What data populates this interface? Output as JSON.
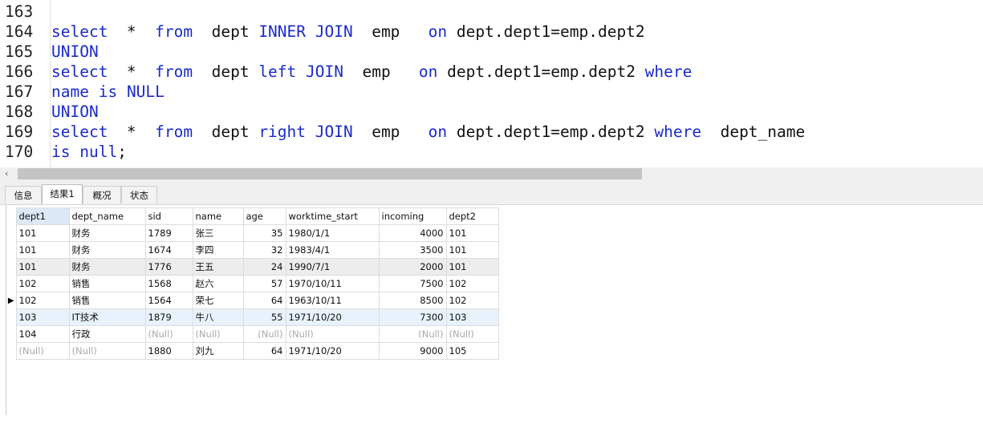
{
  "editor": {
    "lines": [
      {
        "num": "163",
        "tokens": []
      },
      {
        "num": "164",
        "tokens": [
          {
            "t": "select",
            "kw": true
          },
          {
            "t": "  *  ",
            "kw": false
          },
          {
            "t": "from",
            "kw": true
          },
          {
            "t": "  dept ",
            "kw": false
          },
          {
            "t": "INNER JOIN",
            "kw": true
          },
          {
            "t": "  emp   ",
            "kw": false
          },
          {
            "t": "on",
            "kw": true
          },
          {
            "t": " dept.dept1=emp.dept2",
            "kw": false
          }
        ]
      },
      {
        "num": "165",
        "tokens": [
          {
            "t": "UNION",
            "kw": true
          }
        ]
      },
      {
        "num": "166",
        "tokens": [
          {
            "t": "select",
            "kw": true
          },
          {
            "t": "  *  ",
            "kw": false
          },
          {
            "t": "from",
            "kw": true
          },
          {
            "t": "  dept ",
            "kw": false
          },
          {
            "t": "left JOIN",
            "kw": true
          },
          {
            "t": "  emp   ",
            "kw": false
          },
          {
            "t": "on",
            "kw": true
          },
          {
            "t": " dept.dept1=emp.dept2 ",
            "kw": false
          },
          {
            "t": "where",
            "kw": true
          }
        ]
      },
      {
        "num": "167",
        "tokens": [
          {
            "t": "name ",
            "kw": true
          },
          {
            "t": "is",
            "kw": true
          },
          {
            "t": " ",
            "kw": false
          },
          {
            "t": "NULL",
            "kw": true
          }
        ]
      },
      {
        "num": "168",
        "tokens": [
          {
            "t": "UNION",
            "kw": true
          }
        ]
      },
      {
        "num": "169",
        "tokens": [
          {
            "t": "select",
            "kw": true
          },
          {
            "t": "  *  ",
            "kw": false
          },
          {
            "t": "from",
            "kw": true
          },
          {
            "t": "  dept ",
            "kw": false
          },
          {
            "t": "right JOIN",
            "kw": true
          },
          {
            "t": "  emp   ",
            "kw": false
          },
          {
            "t": "on",
            "kw": true
          },
          {
            "t": " dept.dept1=emp.dept2 ",
            "kw": false
          },
          {
            "t": "where",
            "kw": true
          },
          {
            "t": "  dept_name",
            "kw": false
          }
        ]
      },
      {
        "num": "170",
        "tokens": [
          {
            "t": "is",
            "kw": true
          },
          {
            "t": " ",
            "kw": false
          },
          {
            "t": "null",
            "kw": true
          },
          {
            "t": ";",
            "kw": false
          }
        ]
      }
    ]
  },
  "scrollbar": {
    "left_arrow": "‹"
  },
  "tabs": [
    {
      "label": "信息",
      "active": false
    },
    {
      "label": "结果1",
      "active": true
    },
    {
      "label": "概况",
      "active": false
    },
    {
      "label": "状态",
      "active": false
    }
  ],
  "grid": {
    "columns": [
      "dept1",
      "dept_name",
      "sid",
      "name",
      "age",
      "worktime_start",
      "incoming",
      "dept2"
    ],
    "numeric_columns": [
      "age",
      "incoming"
    ],
    "rows": [
      {
        "cells": [
          "101",
          "财务",
          "1789",
          "张三",
          "35",
          "1980/1/1",
          "4000",
          "101"
        ]
      },
      {
        "cells": [
          "101",
          "财务",
          "1674",
          "李四",
          "32",
          "1983/4/1",
          "3500",
          "101"
        ]
      },
      {
        "cells": [
          "101",
          "财务",
          "1776",
          "王五",
          "24",
          "1990/7/1",
          "2000",
          "101"
        ]
      },
      {
        "cells": [
          "102",
          "销售",
          "1568",
          "赵六",
          "57",
          "1970/10/11",
          "7500",
          "102"
        ]
      },
      {
        "cells": [
          "102",
          "销售",
          "1564",
          "荣七",
          "64",
          "1963/10/11",
          "8500",
          "102"
        ],
        "current": true
      },
      {
        "cells": [
          "103",
          "IT技术",
          "1879",
          "牛八",
          "55",
          "1971/10/20",
          "7300",
          "103"
        ]
      },
      {
        "cells": [
          "104",
          "行政",
          "(Null)",
          "(Null)",
          "(Null)",
          "(Null)",
          "(Null)",
          "(Null)"
        ]
      },
      {
        "cells": [
          "(Null)",
          "(Null)",
          "1880",
          "刘九",
          "64",
          "1971/10/20",
          "9000",
          "105"
        ]
      }
    ],
    "row_indicator": "▶"
  }
}
